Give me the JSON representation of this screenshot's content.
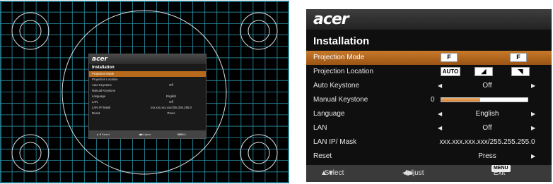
{
  "test_pattern": {
    "name": "projector-test-grid",
    "line_color": "#2b8fa6"
  },
  "menu": {
    "logo_text": "acer",
    "title": "Installation",
    "selected_color": "#b86a1c",
    "items": [
      {
        "label": "Projection Mode",
        "type": "icons",
        "icons": [
          "F",
          "F"
        ]
      },
      {
        "label": "Projection Location",
        "type": "icons",
        "icons": [
          "AUTO",
          "floor-icon",
          "ceiling-icon"
        ]
      },
      {
        "label": "Auto Keystone",
        "type": "select",
        "value": "Off"
      },
      {
        "label": "Manual Keystone",
        "type": "slider",
        "value": "0",
        "level_fraction": 0.45
      },
      {
        "label": "Language",
        "type": "select",
        "value": "English"
      },
      {
        "label": "LAN",
        "type": "select",
        "value": "Off"
      },
      {
        "label": "LAN IP/ Mask",
        "type": "text",
        "value": "xxx.xxx.xxx.xxx/255.255.255.0"
      },
      {
        "label": "Reset",
        "type": "action",
        "value": "Press"
      }
    ],
    "footer": {
      "select": "Select",
      "adjust": "Adjust",
      "menu_key": "MENU",
      "exit": "Exit"
    }
  }
}
